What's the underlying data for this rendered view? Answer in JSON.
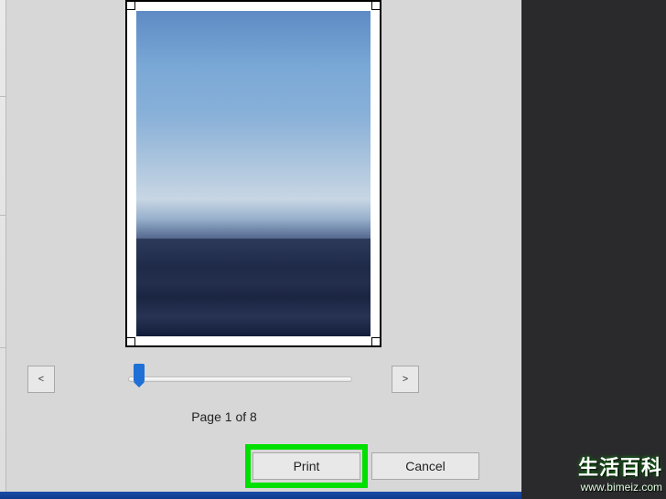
{
  "nav": {
    "prev_label": "<",
    "next_label": ">"
  },
  "pagination": {
    "current": 1,
    "total": 8,
    "label": "Page 1 of 8"
  },
  "slider": {
    "value": 5,
    "min": 0,
    "max": 100
  },
  "buttons": {
    "print_label": "Print",
    "cancel_label": "Cancel"
  },
  "watermark": {
    "main_text": "生活百科",
    "url_text": "www.bimeiz.com"
  }
}
